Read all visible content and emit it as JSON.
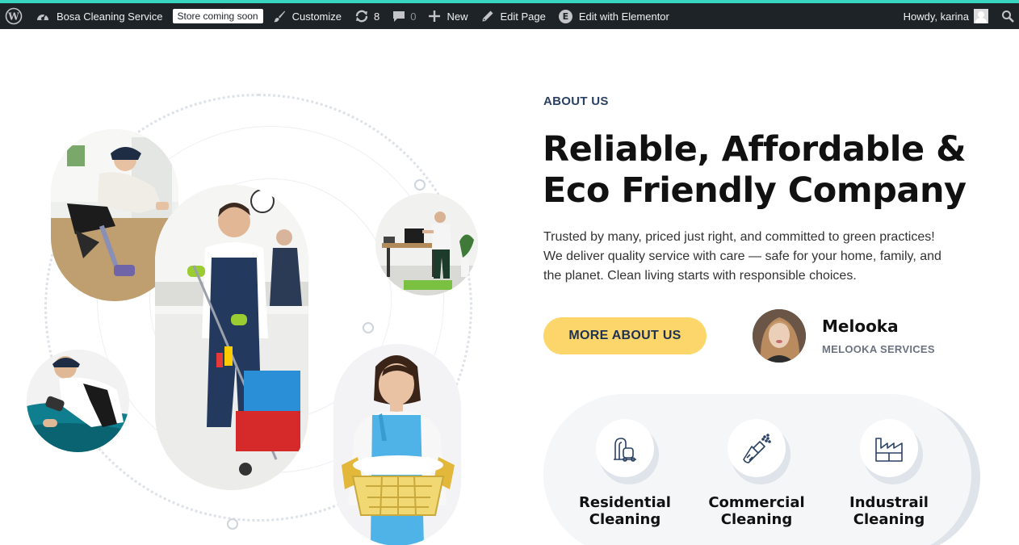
{
  "admin_bar": {
    "site_name": "Bosa Cleaning Service",
    "store_badge": "Store coming soon",
    "customize": "Customize",
    "updates_count": "8",
    "comments_count": "0",
    "new": "New",
    "edit_page": "Edit Page",
    "edit_elementor": "Edit with Elementor",
    "howdy": "Howdy, karina",
    "icons": [
      "wordpress-icon",
      "dashboard-icon",
      "brush-icon",
      "updates-icon",
      "comment-icon",
      "plus-icon",
      "pencil-icon",
      "elementor-icon",
      "search-icon"
    ]
  },
  "about": {
    "label": "ABOUT US",
    "headline_line1": "Reliable, Affordable &",
    "headline_line2": "Eco Friendly Company",
    "desc_line1": "Trusted by many, priced just right, and committed to green practices!",
    "desc_line2": "We deliver quality service with care — safe for your home, family, and",
    "desc_line3": "the planet. Clean living starts with responsible choices.",
    "button": "MORE ABOUT US"
  },
  "author": {
    "name": "Melooka",
    "role": "MELOOKA SERVICES"
  },
  "services": [
    {
      "line1": "Residential",
      "line2": "Cleaning",
      "icon": "vacuum-icon"
    },
    {
      "line1": "Commercial",
      "line2": "Cleaning",
      "icon": "brush-spray-icon"
    },
    {
      "line1": "Industrail",
      "line2": "Cleaning",
      "icon": "factory-icon"
    }
  ],
  "colors": {
    "admin_bar_bg": "#1d2327",
    "accent_button": "#fdd66b",
    "label_blue": "#2b4163",
    "icon_blue": "#2b4163",
    "services_bg": "#f4f6f8"
  }
}
